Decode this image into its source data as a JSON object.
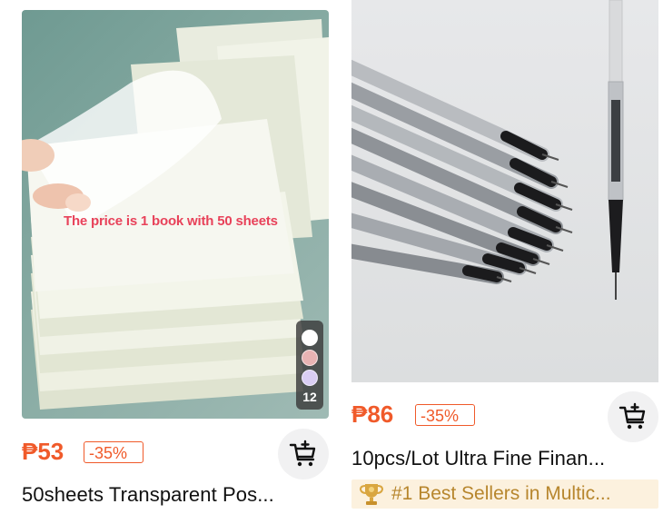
{
  "products": [
    {
      "image_overlay_text": "The price is 1 book with 50 sheets",
      "variant_swatches": [
        "#ffffff",
        "#e8b3b3",
        "#d9cdf3"
      ],
      "variant_count": "12",
      "price": "₱53",
      "discount": "-35%",
      "title": "50sheets Transparent Pos..."
    },
    {
      "price": "₱86",
      "discount": "-35%",
      "title": "10pcs/Lot Ultra Fine Finan...",
      "badge": "#1 Best Sellers in Multic..."
    }
  ],
  "colors": {
    "price": "#f05a2a",
    "badge_bg": "#fcf1de",
    "badge_text": "#b7862d"
  },
  "icons": {
    "cart": "add-to-cart-icon",
    "trophy": "trophy-icon"
  }
}
